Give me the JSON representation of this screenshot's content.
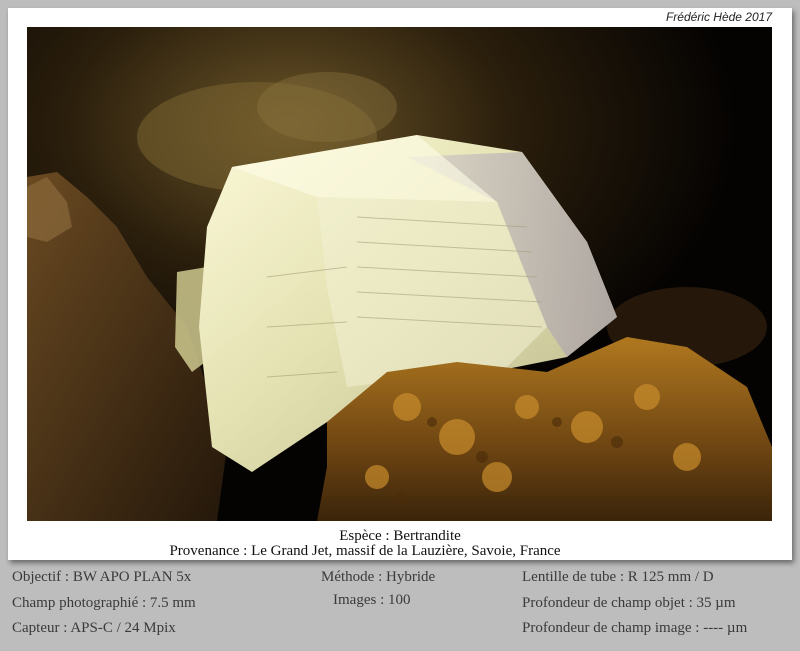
{
  "credit": "Frédéric Hède 2017",
  "caption": {
    "species": "Espèce : Bertrandite",
    "provenance": "Provenance : Le Grand Jet, massif de la Lauzière, Savoie, France"
  },
  "specs": {
    "left": [
      "Objectif : BW APO PLAN 5x",
      "Champ photographié : 7.5 mm",
      "Capteur : APS-C / 24 Mpix"
    ],
    "center": [
      "Méthode : Hybride",
      "Images : 100"
    ],
    "right": [
      "Lentille de tube : R 125 mm / D",
      "Profondeur de champ objet : 35 µm",
      "Profondeur de champ image : ---- µm"
    ]
  },
  "colors": {
    "page_background": "#bdbdbd",
    "frame": "#ffffff",
    "photo_background": "#050302",
    "crystal": "#e9e7b8",
    "matrix": "#8a5a1a"
  }
}
